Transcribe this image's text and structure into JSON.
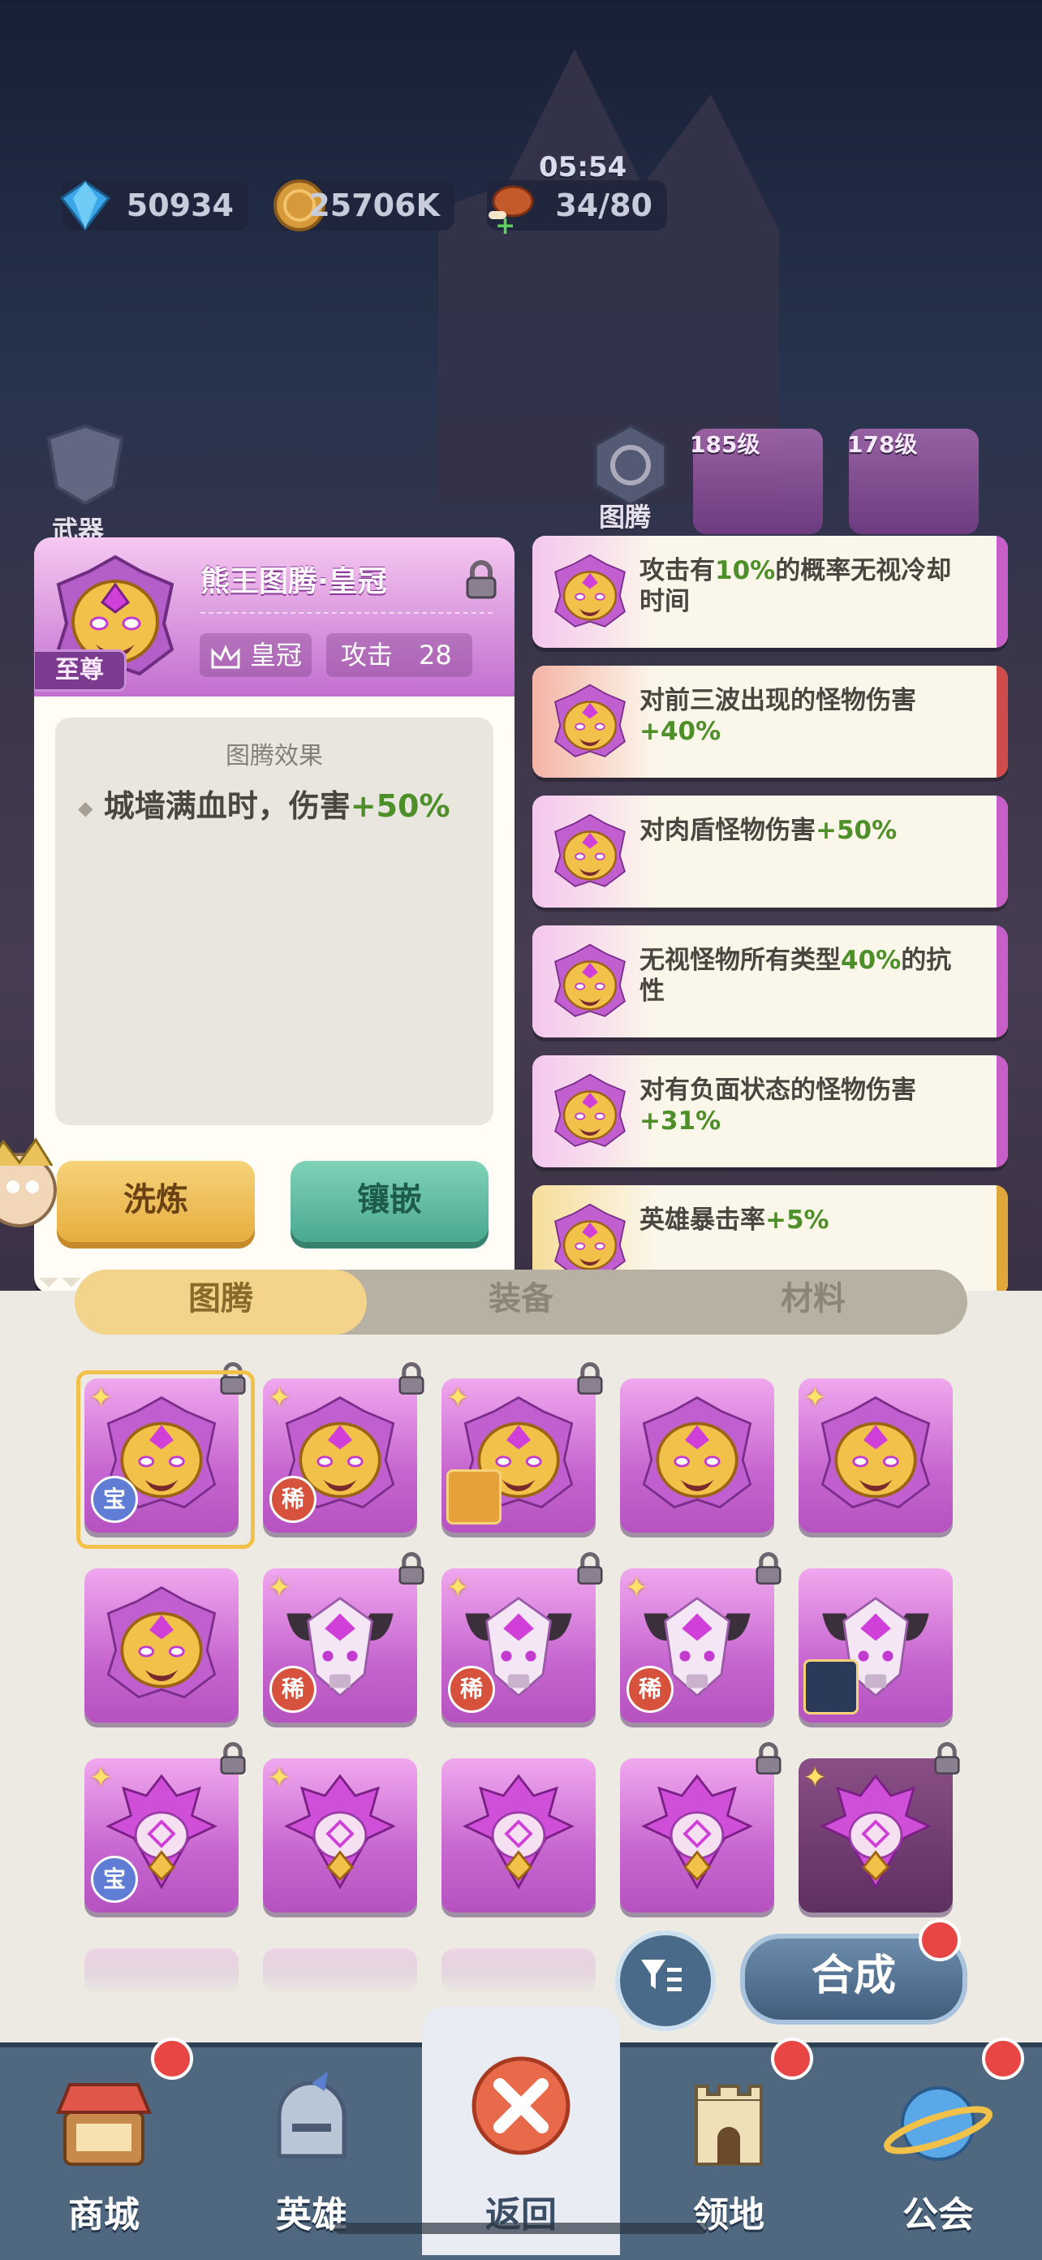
{
  "top": {
    "gems": "50934",
    "gold": "25706K",
    "stamina": "34/80",
    "timer": "05:54"
  },
  "background": {
    "weapon_label": "武器",
    "totem_label": "图腾",
    "slot1_level": "185级",
    "slot2_level": "178级"
  },
  "panel": {
    "item_name": "熊王图腾·皇冠",
    "rank": "至尊",
    "type_label": "皇冠",
    "attack_label": "攻击",
    "attack_value": "28",
    "effect_title": "图腾效果",
    "effect_text": "城墙满血时，伤害",
    "effect_value": "+50%",
    "btn_refine": "洗炼",
    "btn_inlay": "镶嵌"
  },
  "effects_list": [
    {
      "pre": "攻击有",
      "hl": "10%",
      "post": "的概率无视冷却时间",
      "stripe": "#c85fc8",
      "band": "#f4c6ee"
    },
    {
      "pre": "对前三波出现的怪物伤害",
      "hl": "+40%",
      "post": "",
      "stripe": "#d04b4b",
      "band": "#f4b4a6"
    },
    {
      "pre": "对肉盾怪物伤害",
      "hl": "+50%",
      "post": "",
      "stripe": "#c85fc8",
      "band": "#f4c6ee"
    },
    {
      "pre": "无视怪物所有类型",
      "hl": "40%",
      "post": "的抗性",
      "stripe": "#c85fc8",
      "band": "#f4c6ee"
    },
    {
      "pre": "对有负面状态的怪物伤害",
      "hl": "+31%",
      "post": "",
      "stripe": "#c85fc8",
      "band": "#f4c6ee"
    },
    {
      "pre": "英雄暴击率",
      "hl": "+5%",
      "post": "",
      "stripe": "#e0a83a",
      "band": "#f6dd9a"
    }
  ],
  "tabs": [
    "图腾",
    "装备",
    "材料"
  ],
  "grid_badges": {
    "bao": "宝",
    "xi": "稀"
  },
  "combine_label": "合成",
  "nav": [
    {
      "label": "商城",
      "icon": "shop-icon"
    },
    {
      "label": "英雄",
      "icon": "hero-helmet-icon"
    },
    {
      "label": "返回",
      "icon": "close-icon"
    },
    {
      "label": "领地",
      "icon": "castle-icon"
    },
    {
      "label": "公会",
      "icon": "guild-planet-icon"
    }
  ],
  "colors": {
    "accent_purple": "#c766d0",
    "highlight_green": "#4e8f2a",
    "nav_bg": "#4f6880"
  }
}
